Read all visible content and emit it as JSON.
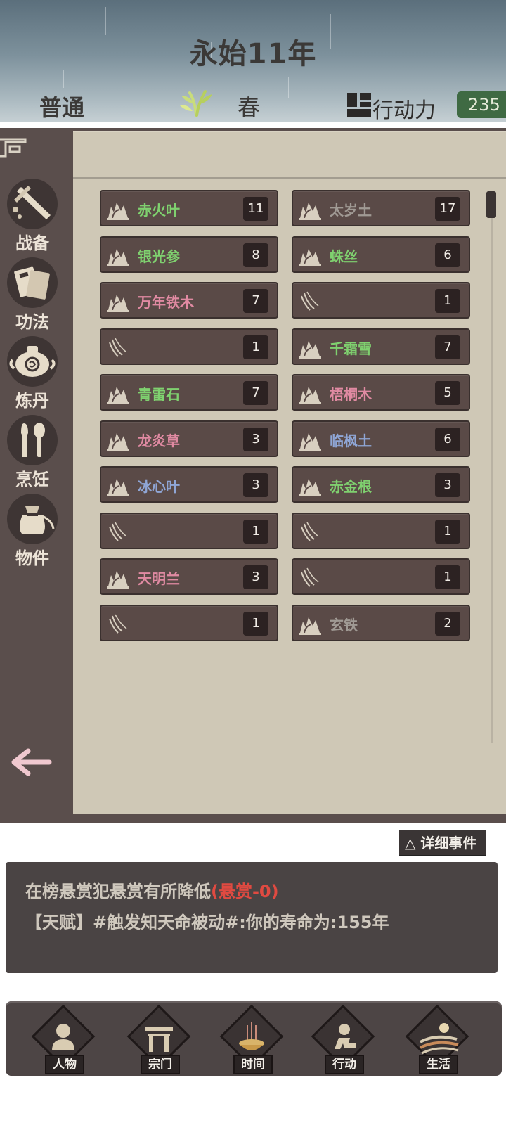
{
  "header": {
    "year_title": "永始11年",
    "difficulty": "普通",
    "season": "春",
    "action_label": "行动力",
    "action_points": "235"
  },
  "sidebar": {
    "items": [
      {
        "label": "战备",
        "icon": "sword-icon"
      },
      {
        "label": "功法",
        "icon": "book-icon"
      },
      {
        "label": "炼丹",
        "icon": "cauldron-icon"
      },
      {
        "label": "烹饪",
        "icon": "spoon-knife-icon"
      },
      {
        "label": "物件",
        "icon": "pouch-icon"
      }
    ],
    "back_icon": "back-arrow-icon"
  },
  "materials": [
    {
      "name": "赤火叶",
      "count": "11",
      "color": "#7fd16f",
      "icon": "herb-icon"
    },
    {
      "name": "太岁土",
      "count": "17",
      "color": "#a09a94",
      "icon": "herb-icon"
    },
    {
      "name": "银光参",
      "count": "8",
      "color": "#7fd16f",
      "icon": "herb-icon"
    },
    {
      "name": "蛛丝",
      "count": "6",
      "color": "#7fd16f",
      "icon": "herb-icon"
    },
    {
      "name": "万年铁木",
      "count": "7",
      "color": "#e08aa2",
      "icon": "herb-icon"
    },
    {
      "name": "",
      "count": "1",
      "color": "#a09a94",
      "icon": "claw-icon"
    },
    {
      "name": "",
      "count": "1",
      "color": "#a09a94",
      "icon": "claw-icon"
    },
    {
      "name": "千霜雪",
      "count": "7",
      "color": "#7fd16f",
      "icon": "herb-icon"
    },
    {
      "name": "青雷石",
      "count": "7",
      "color": "#7fd16f",
      "icon": "herb-icon"
    },
    {
      "name": "梧桐木",
      "count": "5",
      "color": "#e08aa2",
      "icon": "herb-icon"
    },
    {
      "name": "龙炎草",
      "count": "3",
      "color": "#e08aa2",
      "icon": "herb-icon"
    },
    {
      "name": "临枫土",
      "count": "6",
      "color": "#8fa6d6",
      "icon": "herb-icon"
    },
    {
      "name": "冰心叶",
      "count": "3",
      "color": "#8fa6d6",
      "icon": "herb-icon"
    },
    {
      "name": "赤金根",
      "count": "3",
      "color": "#7fd16f",
      "icon": "herb-icon"
    },
    {
      "name": "",
      "count": "1",
      "color": "#a09a94",
      "icon": "claw-icon"
    },
    {
      "name": "",
      "count": "1",
      "color": "#a09a94",
      "icon": "claw-icon"
    },
    {
      "name": "天明兰",
      "count": "3",
      "color": "#e08aa2",
      "icon": "herb-icon"
    },
    {
      "name": "",
      "count": "1",
      "color": "#a09a94",
      "icon": "claw-icon"
    },
    {
      "name": "",
      "count": "1",
      "color": "#a09a94",
      "icon": "claw-icon"
    },
    {
      "name": "玄铁",
      "count": "2",
      "color": "#a09a94",
      "icon": "herb-icon"
    }
  ],
  "log": {
    "detail_button": "△ 详细事件",
    "line1_text": "在榜悬赏犯悬赏有所降低",
    "line1_highlight": "(悬赏-0)",
    "line2_text": "【天赋】#触发知天命被动#:你的寿命为:155年"
  },
  "nav": [
    {
      "label": "人物",
      "icon": "person-icon"
    },
    {
      "label": "宗门",
      "icon": "gate-icon"
    },
    {
      "label": "时间",
      "icon": "incense-icon"
    },
    {
      "label": "行动",
      "icon": "action-icon"
    },
    {
      "label": "生活",
      "icon": "landscape-icon"
    }
  ]
}
